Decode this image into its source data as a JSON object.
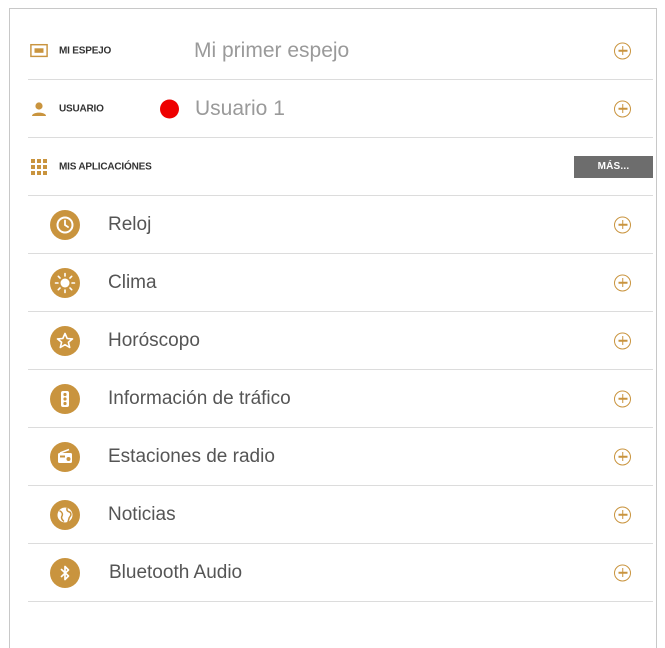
{
  "mirror": {
    "label": "MI ESPEJO",
    "value": "Mi primer espejo",
    "icon": "mirror-screen-icon"
  },
  "user": {
    "label": "USUARIO",
    "value": "Usuario 1",
    "status_color": "#ee0000",
    "icon": "user-icon"
  },
  "apps_section": {
    "label": "MIS APLICACIÓNES",
    "more_label": "MÁS...",
    "icon": "grid-icon"
  },
  "apps": [
    {
      "label": "Reloj",
      "icon": "clock-icon"
    },
    {
      "label": "Clima",
      "icon": "sun-icon"
    },
    {
      "label": "Horóscopo",
      "icon": "star-icon"
    },
    {
      "label": "Información de tráfico",
      "icon": "traffic-light-icon"
    },
    {
      "label": "Estaciones de radio",
      "icon": "radio-icon"
    },
    {
      "label": "Noticias",
      "icon": "globe-icon"
    },
    {
      "label": "Bluetooth Audio",
      "icon": "bluetooth-icon"
    }
  ],
  "colors": {
    "accent": "#c9943e",
    "more_button": "#6d6d6d"
  }
}
